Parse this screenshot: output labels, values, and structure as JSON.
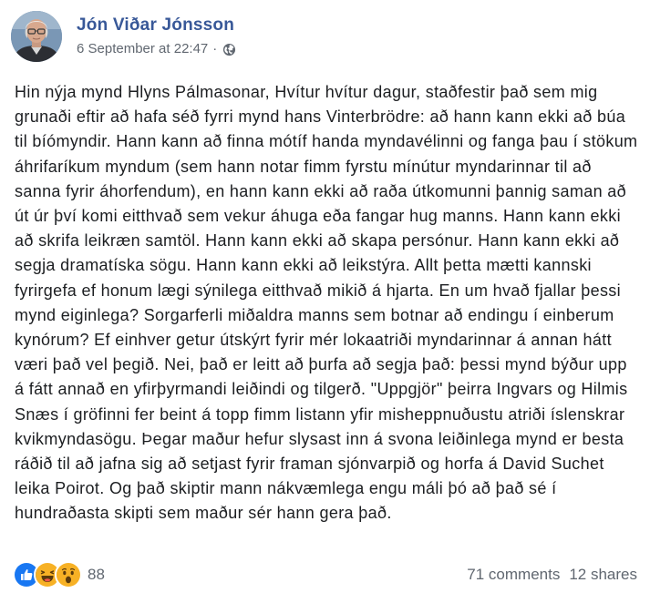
{
  "post": {
    "author": "Jón Viðar Jónsson",
    "timestamp": "6 September at 22:47",
    "separator": "·",
    "audience_icon": "globe-icon",
    "body": "Hin nýja mynd Hlyns Pálmasonar, Hvítur hvítur dagur, staðfestir það sem mig grunaði eftir að hafa séð fyrri mynd hans Vinterbrödre: að hann kann ekki að búa til bíómyndir. Hann kann að finna mótíf handa myndavélinni og fanga þau í stökum áhrifaríkum myndum (sem hann notar fimm fyrstu mínútur myndarinnar til að sanna fyrir áhorfendum), en hann kann ekki að raða útkomunni þannig saman að út úr því komi eitthvað sem vekur áhuga eða fangar hug manns. Hann kann ekki að skrifa leikræn samtöl. Hann kann ekki að skapa persónur. Hann kann ekki að segja dramatíska sögu. Hann kann ekki að leikstýra. Allt þetta mætti kannski fyrirgefa ef honum lægi sýnilega eitthvað mikið á hjarta. En um hvað fjallar þessi mynd eiginlega? Sorgarferli miðaldra manns sem botnar að endingu í einberum kynórum? Ef einhver getur útskýrt fyrir mér lokaatriði myndarinnar á annan hátt væri það vel þegið. Nei, það er leitt að þurfa að segja það: þessi mynd býður upp á fátt annað en yfirþyrmandi leiðindi og tilgerð. \"Uppgjör\" þeirra Ingvars og Hilmis Snæs í gröfinni fer beint á topp fimm listann yfir misheppnuðustu atriði íslenskrar kvikmyndasögu. Þegar maður hefur slysast inn á svona leiðinlega mynd er besta ráðið til að jafna sig að setjast fyrir framan sjónvarpið og horfa á David Suchet leika Poirot. Og það skiptir mann nákvæmlega engu máli þó að það sé í hundraðasta skipti sem maður sér hann gera það."
  },
  "reactions": {
    "icons": [
      "like-icon",
      "haha-icon",
      "wow-icon"
    ],
    "count": "88"
  },
  "stats": {
    "comments": "71 comments",
    "shares": "12 shares"
  },
  "colors": {
    "author": "#385898",
    "secondary_text": "#606770",
    "body_text": "#1c1e21",
    "like": "#1877f2",
    "emoji": "#f7b125"
  }
}
